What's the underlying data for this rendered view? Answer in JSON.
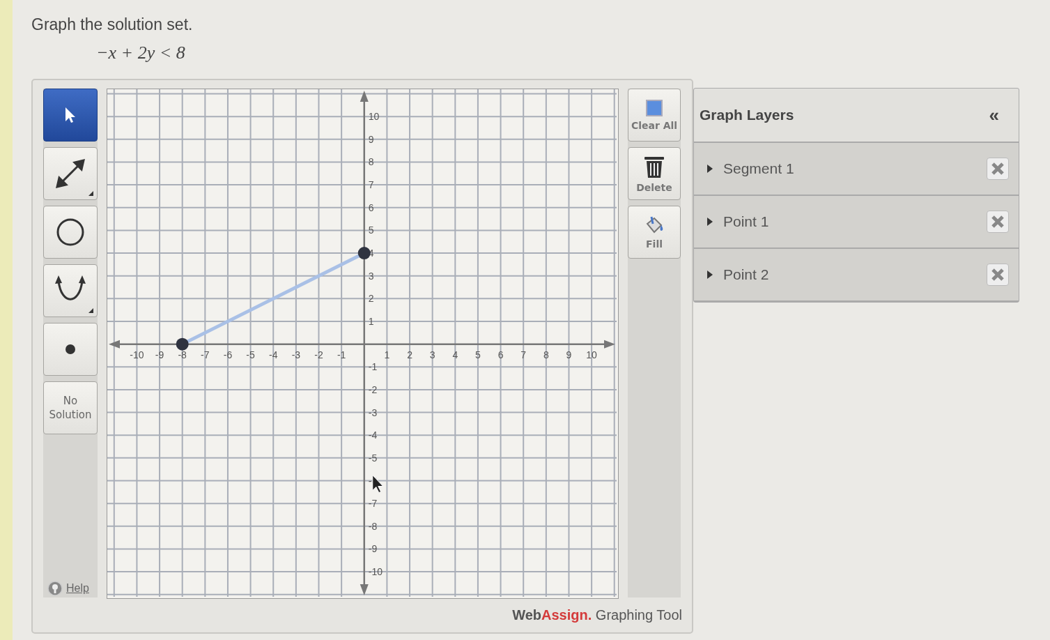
{
  "question": {
    "prompt": "Graph the solution set.",
    "inequality": "−x + 2y < 8"
  },
  "tools": [
    {
      "kind": "pointer",
      "selected": true
    },
    {
      "kind": "line",
      "selected": false
    },
    {
      "kind": "circle",
      "selected": false
    },
    {
      "kind": "parabola",
      "selected": false
    },
    {
      "kind": "point",
      "selected": false
    },
    {
      "kind": "text",
      "label": "No Solution",
      "selected": false
    }
  ],
  "help_link": "Help",
  "graph": {
    "chart_data": {
      "type": "line",
      "x": [
        -8,
        0
      ],
      "series": [
        {
          "color": "#a9c0e6",
          "marker": "circle",
          "values": [
            0,
            4
          ]
        }
      ],
      "grid": true,
      "xlim": [
        -11.3,
        11.1
      ],
      "ylim": [
        -11.1,
        11.2
      ],
      "xticks": [
        -10,
        -9,
        -8,
        -7,
        -6,
        -5,
        -4,
        -3,
        -2,
        -1,
        1,
        2,
        3,
        4,
        5,
        6,
        7,
        8,
        9,
        10
      ],
      "yticks": [
        -10,
        -9,
        -8,
        -7,
        -6,
        -5,
        -4,
        -3,
        -2,
        -1,
        1,
        2,
        3,
        4,
        5,
        6,
        7,
        8,
        9,
        10
      ]
    }
  },
  "actions": [
    {
      "kind": "clear",
      "label": "Clear All"
    },
    {
      "kind": "delete",
      "label": "Delete"
    },
    {
      "kind": "fill",
      "label": "Fill"
    }
  ],
  "credit": {
    "brand": "Web",
    "brand_accent": "Assign.",
    "product": "Graphing Tool"
  },
  "layers": {
    "title": "Graph Layers",
    "collapse": "«",
    "items": [
      {
        "label": "Segment 1",
        "expanded": false
      },
      {
        "label": "Point 1",
        "expanded": false
      },
      {
        "label": "Point 2",
        "expanded": false
      }
    ]
  }
}
